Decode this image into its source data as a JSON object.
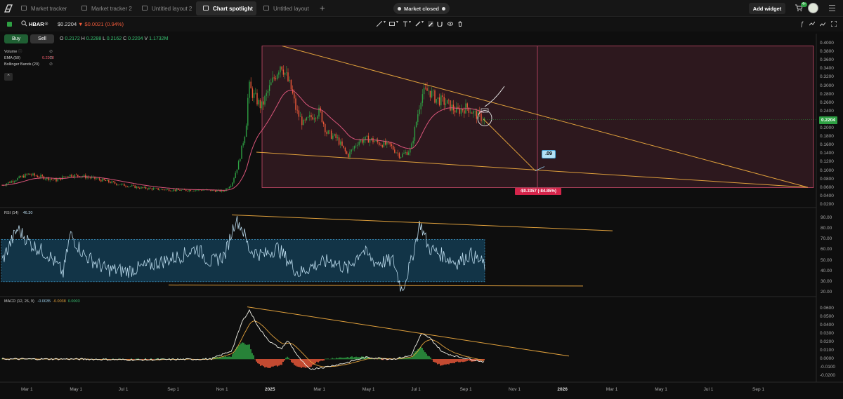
{
  "tabs": [
    {
      "label": "Market tracker",
      "active": false
    },
    {
      "label": "Market tracker 2",
      "active": false
    },
    {
      "label": "Untitled layout 2",
      "active": false
    },
    {
      "label": "Chart spotlight",
      "active": true
    },
    {
      "label": "Untitled layout",
      "active": false
    }
  ],
  "header": {
    "market_status": "Market closed",
    "add_widget": "Add widget",
    "cart_badge": "4+"
  },
  "symbol": {
    "name": "HBAR",
    "price": "$0.2204",
    "change": "▼ $0.0021 (0.94%)"
  },
  "trade": {
    "buy": "Buy",
    "sell": "Sell"
  },
  "ohlc": {
    "o_label": "O",
    "o": "0.2172",
    "h_label": "H",
    "h": "0.2288",
    "l_label": "L",
    "l": "0.2162",
    "c_label": "C",
    "c": "0.2204",
    "v_label": "V",
    "v": "1.1732M"
  },
  "legend": {
    "volume": "Volume",
    "ema": "EMA (50)",
    "ema_value": "0.2278",
    "bb": "Bollinger Bands (20)"
  },
  "rsi": {
    "label": "RSI (14)",
    "value": "46.30"
  },
  "macd": {
    "label": "MACD (12, 26, 9)",
    "v1": "-0.0035",
    "v2": "-0.0038",
    "v3": "0.0003"
  },
  "price_axis": [
    "0.4000",
    "0.3800",
    "0.3600",
    "0.3400",
    "0.3200",
    "0.3000",
    "0.2800",
    "0.2600",
    "0.2400",
    "0.2200",
    "0.2000",
    "0.1800",
    "0.1600",
    "0.1400",
    "0.1200",
    "0.1000",
    "0.0800",
    "0.0600",
    "0.0400",
    "0.0200"
  ],
  "price_tag": "0.2204",
  "rsi_axis": [
    "90.00",
    "80.00",
    "70.00",
    "60.00",
    "50.00",
    "40.00",
    "30.00",
    "20.00"
  ],
  "macd_axis": [
    "0.0600",
    "0.0500",
    "0.0400",
    "0.0300",
    "0.0200",
    "0.0100",
    "0.0000",
    "-0.0100",
    "-0.0200"
  ],
  "time_axis": [
    {
      "label": "Mar 1",
      "bold": false
    },
    {
      "label": "May 1",
      "bold": false
    },
    {
      "label": "Jul 1",
      "bold": false
    },
    {
      "label": "Sep 1",
      "bold": false
    },
    {
      "label": "Nov 1",
      "bold": false
    },
    {
      "label": "2025",
      "bold": true
    },
    {
      "label": "Mar 1",
      "bold": false
    },
    {
      "label": "May 1",
      "bold": false
    },
    {
      "label": "Jul 1",
      "bold": false
    },
    {
      "label": "Sep 1",
      "bold": false
    },
    {
      "label": "Nov 1",
      "bold": false
    },
    {
      "label": "2026",
      "bold": true
    },
    {
      "label": "Mar 1",
      "bold": false
    },
    {
      "label": "May 1",
      "bold": false
    },
    {
      "label": "Jul 1",
      "bold": false
    },
    {
      "label": "Sep 1",
      "bold": false
    }
  ],
  "annotations": {
    "target_callout": ".09",
    "measure": "-$0.3357 (-84.85%)"
  },
  "colors": {
    "up": "#2ea043",
    "down": "#f05a3a",
    "ema": "#d9557a",
    "trendline": "#e0a03c",
    "rsi_line": "#b8d8ea",
    "rsi_band": "#123447",
    "macd_line": "#f2f2e8",
    "signal_line": "#e0a03c",
    "measure_box": "#5a2a35"
  }
}
